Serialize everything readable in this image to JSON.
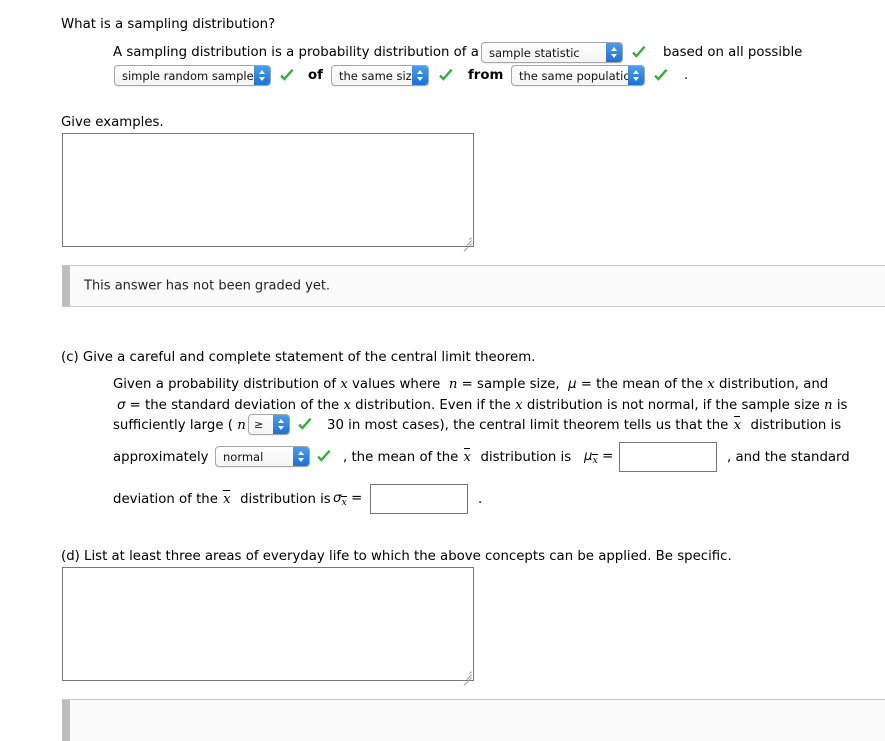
{
  "colors": {
    "check_green": "#3aad3a",
    "select_blue": "#1a72d6",
    "notice_bar": "#bdbdbd",
    "notice_bg": "#fbfbfb",
    "page_bg": "#ffffff"
  },
  "question_b": {
    "prompt": "What is a sampling distribution?",
    "line1_pre": "A sampling distribution is a probability distribution of a",
    "line1_post": "based on all possible",
    "line2_of": "of",
    "line2_from": "from",
    "line2_period": ".",
    "selects": [
      {
        "name": "sample-statistic",
        "value": "sample statistic",
        "verified": true
      },
      {
        "name": "simple-random-samples",
        "value": "simple random samples",
        "verified": true
      },
      {
        "name": "the-same-size",
        "value": "the same size",
        "verified": true
      },
      {
        "name": "the-same-population",
        "value": "the same population",
        "verified": true
      }
    ],
    "examples_prompt": "Give examples.",
    "examples_value": "",
    "examples_placeholder": "",
    "grading_notice": "This answer has not been graded yet."
  },
  "question_c": {
    "prompt": "(c) Give a careful and complete statement of the central limit theorem.",
    "line1": {
      "a": "Given a probability distribution of",
      "x1": "x",
      "b": "values where",
      "n": "n",
      "c": "= sample size,",
      "mu": "μ",
      "d": "= the mean of the",
      "x2": "x",
      "e": "distribution,  and"
    },
    "line2": {
      "sigma": "σ",
      "a": "= the standard deviation of the",
      "x1": "x",
      "b": "distribution.  Even if the",
      "x2": "x",
      "c": "distribution is not normal, if the sample size",
      "n": "n",
      "d": "is"
    },
    "line3": {
      "a": "sufficiently large (",
      "n": "n",
      "select": {
        "name": "inequality",
        "value": "≥",
        "verified": true
      },
      "b": "30  in most cases), the central limit theorem tells us that the",
      "xbar": "x",
      "c": "distribution is"
    },
    "line4": {
      "a": "approximately",
      "select": {
        "name": "approximation-shape",
        "value": "normal",
        "verified": true
      },
      "b": ", the mean of the",
      "xbar": "x",
      "c": "distribution is",
      "mu_symbol": "μ",
      "mu_sub": "x",
      "eq": "=",
      "mean_input_value": "",
      "d": ",  and the standard"
    },
    "line5": {
      "a": "deviation of the",
      "xbar": "x",
      "b": "distribution is",
      "sigma_symbol": "σ",
      "sigma_sub": "x",
      "eq": "=",
      "sd_input_value": "",
      "c": "."
    }
  },
  "question_d": {
    "prompt": "(d) List at least three areas of everyday life to which the above concepts can be applied. Be specific.",
    "answer_value": "",
    "answer_placeholder": ""
  },
  "icons": {
    "checkmark": "green-checkmark-icon",
    "select_arrows": "select-stepper-arrows-icon",
    "resize_grip": "resize-grip-icon"
  }
}
